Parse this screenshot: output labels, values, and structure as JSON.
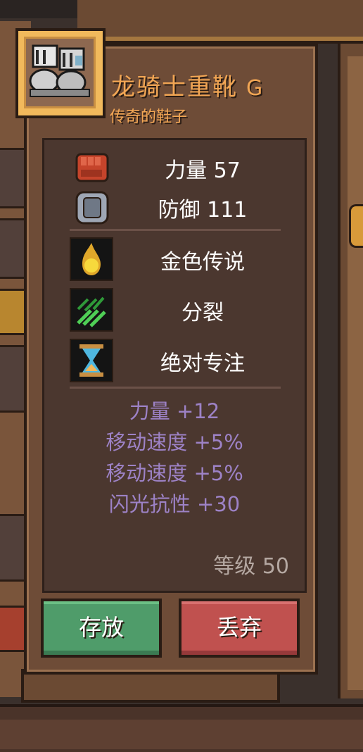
{
  "item": {
    "name": "龙骑士重靴",
    "grade": "G",
    "subtitle": "传奇的鞋子",
    "icon": "iron-boots-icon"
  },
  "stats": [
    {
      "icon": "fist-icon",
      "label": "力量 57"
    },
    {
      "icon": "shield-icon",
      "label": "防御 111"
    }
  ],
  "traits": [
    {
      "icon": "golden-flame-icon",
      "label": "金色传说"
    },
    {
      "icon": "split-arrows-icon",
      "label": "分裂"
    },
    {
      "icon": "hourglass-icon",
      "label": "绝对专注"
    }
  ],
  "bonuses": [
    "力量 +12",
    "移动速度 +5%",
    "移动速度 +5%",
    "闪光抗性 +30"
  ],
  "level": "等级 50",
  "buttons": {
    "store": "存放",
    "drop": "丢弃"
  },
  "colors": {
    "title": "#f2a654",
    "bonus": "#9d82c6",
    "store": "#4f9c6a",
    "drop": "#c0514f"
  }
}
